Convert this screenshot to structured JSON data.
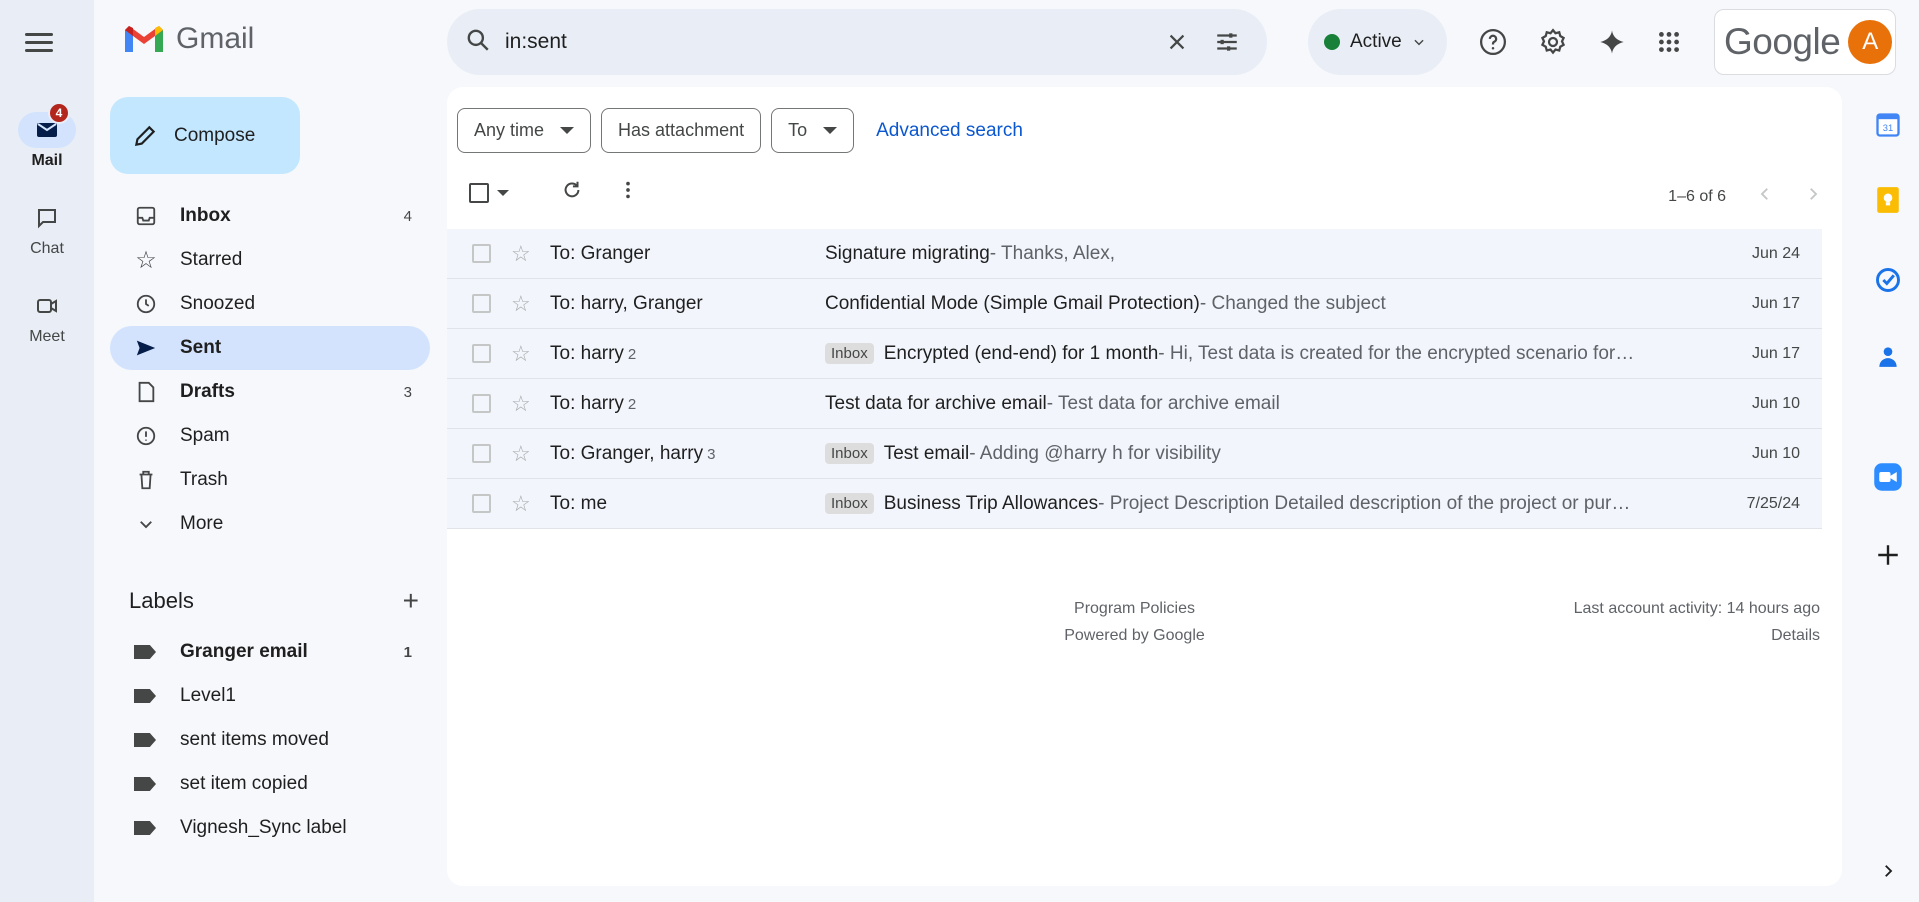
{
  "app": {
    "name": "Gmail"
  },
  "rail": {
    "items": [
      {
        "label": "Mail",
        "badge": "4"
      },
      {
        "label": "Chat"
      },
      {
        "label": "Meet"
      }
    ]
  },
  "compose": {
    "label": "Compose"
  },
  "nav": {
    "items": [
      {
        "label": "Inbox",
        "count": "4"
      },
      {
        "label": "Starred"
      },
      {
        "label": "Snoozed"
      },
      {
        "label": "Sent"
      },
      {
        "label": "Drafts",
        "count": "3"
      },
      {
        "label": "Spam"
      },
      {
        "label": "Trash"
      },
      {
        "label": "More"
      }
    ]
  },
  "labels": {
    "title": "Labels",
    "items": [
      {
        "label": "Granger email",
        "count": "1"
      },
      {
        "label": "Level1"
      },
      {
        "label": "sent items moved"
      },
      {
        "label": "set item copied"
      },
      {
        "label": "Vignesh_Sync label"
      }
    ]
  },
  "search": {
    "value": "in:sent"
  },
  "status": {
    "label": "Active",
    "color": "#188038"
  },
  "account": {
    "google": "Google",
    "avatar": "A"
  },
  "filters": {
    "time": "Any time",
    "attachment": "Has attachment",
    "to": "To",
    "advanced": "Advanced search"
  },
  "pager": {
    "text": "1–6 of 6"
  },
  "emails": [
    {
      "to": "To: Granger",
      "n": "",
      "tag": "",
      "subject": "Signature migrating",
      "snippet": " - Thanks, Alex,",
      "date": "Jun 24"
    },
    {
      "to": "To: harry, Granger",
      "n": "",
      "tag": "",
      "subject": "Confidential Mode (Simple Gmail Protection)",
      "snippet": " - Changed the subject",
      "date": "Jun 17"
    },
    {
      "to": "To: harry",
      "n": "2",
      "tag": "Inbox",
      "subject": "Encrypted (end-end) for 1 month",
      "snippet": " - Hi, Test data is created for the encrypted scenario for…",
      "date": "Jun 17"
    },
    {
      "to": "To: harry",
      "n": "2",
      "tag": "",
      "subject": "Test data for archive email",
      "snippet": " - Test data for archive email",
      "date": "Jun 10"
    },
    {
      "to": "To: Granger, harry",
      "n": "3",
      "tag": "Inbox",
      "subject": "Test email",
      "snippet": " - Adding @harry h for visibility",
      "date": "Jun 10"
    },
    {
      "to": "To: me",
      "n": "",
      "tag": "Inbox",
      "subject": "Business Trip Allowances",
      "snippet": " - Project Description Detailed description of the project or pur…",
      "date": "7/25/24"
    }
  ],
  "footer": {
    "policies": "Program Policies",
    "powered": "Powered by Google",
    "activity": "Last account activity: 14 hours ago",
    "details": "Details"
  }
}
